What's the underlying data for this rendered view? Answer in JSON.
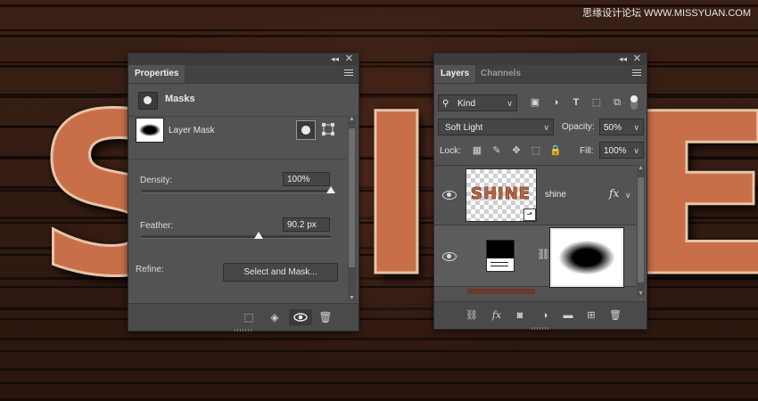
{
  "watermark": "思缘设计论坛 WWW.MISSYUAN.COM",
  "artwork": {
    "letters": [
      "S",
      "I",
      "E"
    ]
  },
  "properties": {
    "tab": "Properties",
    "section_title": "Masks",
    "layer_mask_label": "Layer Mask",
    "density_label": "Density:",
    "density_value": "100%",
    "density_level": 1.0,
    "feather_label": "Feather:",
    "feather_value": "90.2 px",
    "feather_level": 0.62,
    "refine_label": "Refine:",
    "select_and_mask": "Select and Mask..."
  },
  "layers_panel": {
    "tabs": [
      "Layers",
      "Channels"
    ],
    "active_tab": "Layers",
    "filter_kind": "Kind",
    "blend_mode": "Soft Light",
    "opacity_label": "Opacity:",
    "opacity_value": "50%",
    "lock_label": "Lock:",
    "fill_label": "Fill:",
    "fill_value": "100%",
    "layers": [
      {
        "name": "shine",
        "thumb_text": "SHINE",
        "has_fx": true,
        "fx_label": "fx"
      },
      {
        "name": "",
        "type": "adjustment-with-mask"
      }
    ]
  },
  "colors": {
    "panel_bg": "#535353",
    "panel_dark": "#424242",
    "letter_fill": "#c86f4a",
    "letter_stroke": "#e6c5a8"
  },
  "icons": {
    "properties_footer": [
      "marquee-selection-icon",
      "mask-load-icon",
      "visibility-eye-icon",
      "trash-icon"
    ],
    "layers_footer": [
      "link-icon",
      "fx-icon",
      "add-mask-icon",
      "adjustment-icon",
      "folder-icon",
      "new-layer-icon",
      "trash-icon"
    ]
  }
}
